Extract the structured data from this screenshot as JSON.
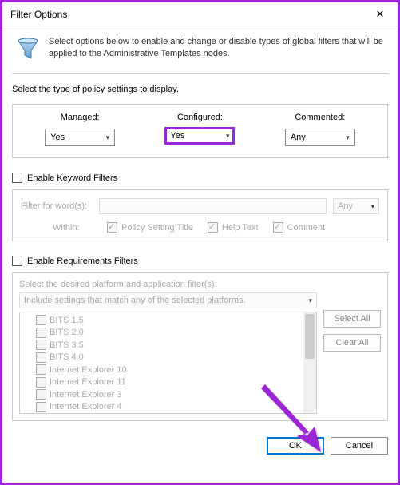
{
  "window": {
    "title": "Filter Options"
  },
  "header": {
    "description": "Select options below to enable and change or disable types of global filters that will be applied to the Administrative Templates nodes."
  },
  "policy": {
    "prompt": "Select the type of policy settings to display.",
    "managed": {
      "label": "Managed:",
      "value": "Yes"
    },
    "configured": {
      "label": "Configured:",
      "value": "Yes"
    },
    "commented": {
      "label": "Commented:",
      "value": "Any"
    }
  },
  "keyword": {
    "enable_label": "Enable Keyword Filters",
    "filter_for_label": "Filter for word(s):",
    "match_value": "Any",
    "within_label": "Within:",
    "opt_title": "Policy Setting Title",
    "opt_help": "Help Text",
    "opt_comment": "Comment"
  },
  "requirements": {
    "enable_label": "Enable Requirements Filters",
    "desc": "Select the desired platform and application filter(s):",
    "mode": "Include settings that match any of the selected platforms.",
    "items": [
      "BITS 1.5",
      "BITS 2.0",
      "BITS 3.5",
      "BITS 4.0",
      "Internet Explorer 10",
      "Internet Explorer 11",
      "Internet Explorer 3",
      "Internet Explorer 4"
    ],
    "select_all": "Select All",
    "clear_all": "Clear All"
  },
  "footer": {
    "ok": "OK",
    "cancel": "Cancel"
  }
}
